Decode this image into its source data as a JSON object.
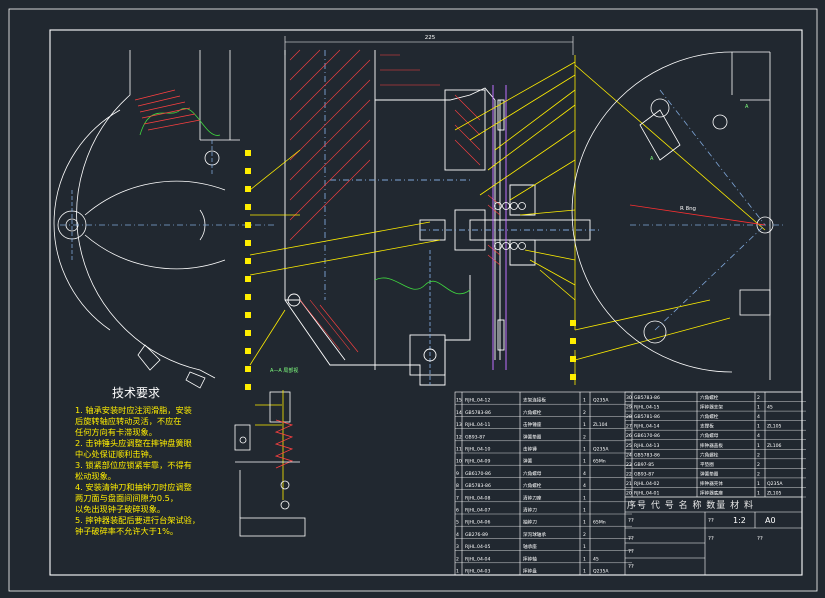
{
  "dimension_top": "225",
  "radius_label": "R 8ng",
  "section_label": "A—A 局部视",
  "section_marks": [
    "A",
    "A"
  ],
  "tech_requirements": {
    "title": "技术要求",
    "items": [
      "1. 轴承安装时应注润滑脂，安装",
      "   后旋转轴应转动灵活，不应在",
      "   任何方向有卡滞现象。",
      "2. 击钟锤头应调整在摔钟盘簧眼",
      "   中心处保证顺利击钟。",
      "3. 锁紧部位应锁紧牢靠，不得有",
      "   松动现象。",
      "4. 安装清钟刀和抽钟刀时应调整",
      "   两刀面与盘面间间隙为0.5，",
      "   以免出现钟子破碎现象。",
      "5. 摔钟器装配后要进行台架试验，",
      "   钟子破碎率不允许大于1%。"
    ]
  },
  "balloons_left": [
    "1",
    "2",
    "3",
    "4",
    "5",
    "6",
    "7",
    "8",
    "9",
    "10",
    "11",
    "12",
    "13",
    "14",
    "15"
  ],
  "parts_left": [
    [
      "15",
      "RJHL.04-12",
      "支架连接板",
      "1",
      "Q235A"
    ],
    [
      "14",
      "GB5783-86",
      "六角螺栓",
      "2",
      ""
    ],
    [
      "13",
      "RJHL.04-11",
      "击钟锤座",
      "1",
      "ZL104"
    ],
    [
      "12",
      "GB93-87",
      "弹簧垫圈",
      "2",
      ""
    ],
    [
      "11",
      "RJHL.04-10",
      "击钟锤",
      "1",
      "Q235A"
    ],
    [
      "10",
      "RJHL.04-09",
      "弹簧",
      "1",
      "65Mn"
    ],
    [
      "9",
      "GB6170-86",
      "六角螺母",
      "4",
      ""
    ],
    [
      "8",
      "GB5783-86",
      "六角螺栓",
      "4",
      ""
    ],
    [
      "7",
      "RJHL.04-08",
      "清钟刀座",
      "1",
      ""
    ],
    [
      "6",
      "RJHL.04-07",
      "清钟刀",
      "1",
      ""
    ],
    [
      "5",
      "RJHL.04-06",
      "抽钟刀",
      "1",
      "65Mn"
    ],
    [
      "4",
      "GB276-89",
      "深沟球轴承",
      "2",
      ""
    ],
    [
      "3",
      "RJHL.04-05",
      "轴承座",
      "1",
      ""
    ],
    [
      "2",
      "RJHL.04-04",
      "摔钟轴",
      "1",
      "45"
    ],
    [
      "1",
      "RJHL.04-03",
      "摔钟盘",
      "1",
      "Q235A"
    ]
  ],
  "parts_right": [
    [
      "30",
      "GB5783-86",
      "六角螺栓",
      "2",
      ""
    ],
    [
      "29",
      "RJHL.04-15",
      "摔钟器支架",
      "1",
      "45"
    ],
    [
      "28",
      "GB5781-86",
      "六角螺栓",
      "4",
      ""
    ],
    [
      "27",
      "RJHL.04-14",
      "支撑板",
      "1",
      "ZL105"
    ],
    [
      "26",
      "GB6170-86",
      "六角螺母",
      "4",
      ""
    ],
    [
      "25",
      "RJHL.04-13",
      "摔钟器盖板",
      "1",
      "ZL106"
    ],
    [
      "24",
      "GB5783-86",
      "六角螺栓",
      "2",
      ""
    ],
    [
      "23",
      "GB97-85",
      "平垫圈",
      "2",
      ""
    ],
    [
      "22",
      "GB93-87",
      "弹簧垫圈",
      "2",
      ""
    ],
    [
      "21",
      "RJHL.04-02",
      "摔钟器壳体",
      "1",
      "Q235A"
    ],
    [
      "20",
      "RJHL.04-01",
      "摔钟器底座",
      "1",
      "ZL105"
    ]
  ],
  "title_block": {
    "header": "序号  代  号   名  称  数量  材  料",
    "scale": "1:2",
    "sheet": "A0",
    "marks": [
      "??",
      "??",
      "??",
      "??",
      "??",
      "??",
      "??"
    ]
  }
}
